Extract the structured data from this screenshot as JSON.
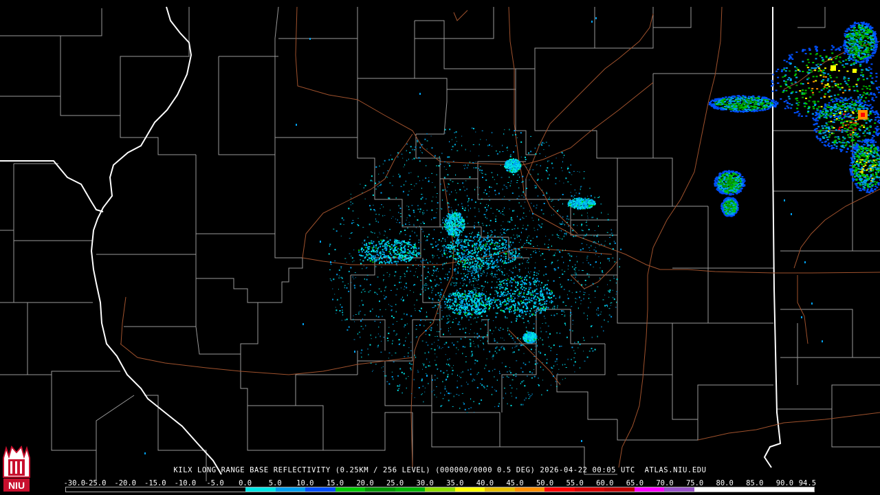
{
  "caption": "KILX LONG RANGE BASE REFLECTIVITY (0.25KM / 256 LEVEL) (000000/0000 0.5 DEG) 2026-04-22 00:05 UTC  ATLAS.NIU.EDU",
  "logo": {
    "text": "NIU",
    "colors": {
      "red": "#c8102e",
      "white": "#ffffff"
    }
  },
  "color_scale": {
    "labels": [
      "-30.0",
      "-25.0",
      "-20.0",
      "-15.0",
      "-10.0",
      "-5.0",
      "0.0",
      "5.0",
      "10.0",
      "15.0",
      "20.0",
      "25.0",
      "30.0",
      "35.0",
      "40.0",
      "45.0",
      "50.0",
      "55.0",
      "60.0",
      "65.0",
      "70.0",
      "75.0",
      "80.0",
      "85.0",
      "90.0",
      "94.5"
    ],
    "colors": [
      "#000000",
      "#000000",
      "#000000",
      "#000000",
      "#000000",
      "#000000",
      "#00e5e5",
      "#00a0f0",
      "#0050ff",
      "#00c800",
      "#009600",
      "#00b400",
      "#90dd00",
      "#ffff00",
      "#e7c000",
      "#ff9000",
      "#ff0000",
      "#d60000",
      "#c00000",
      "#ff00ff",
      "#9955c9",
      "#ffffff",
      "#ffffff",
      "#ffffff",
      "#ffffff"
    ]
  },
  "map": {
    "colors": {
      "county_lines": "#9a9a9a",
      "state_lines": "#ffffff",
      "roads": "#a0522d",
      "background": "#000000"
    },
    "layers": [
      "county-boundaries",
      "state-boundaries",
      "interstate-highways",
      "radar-reflectivity"
    ]
  }
}
